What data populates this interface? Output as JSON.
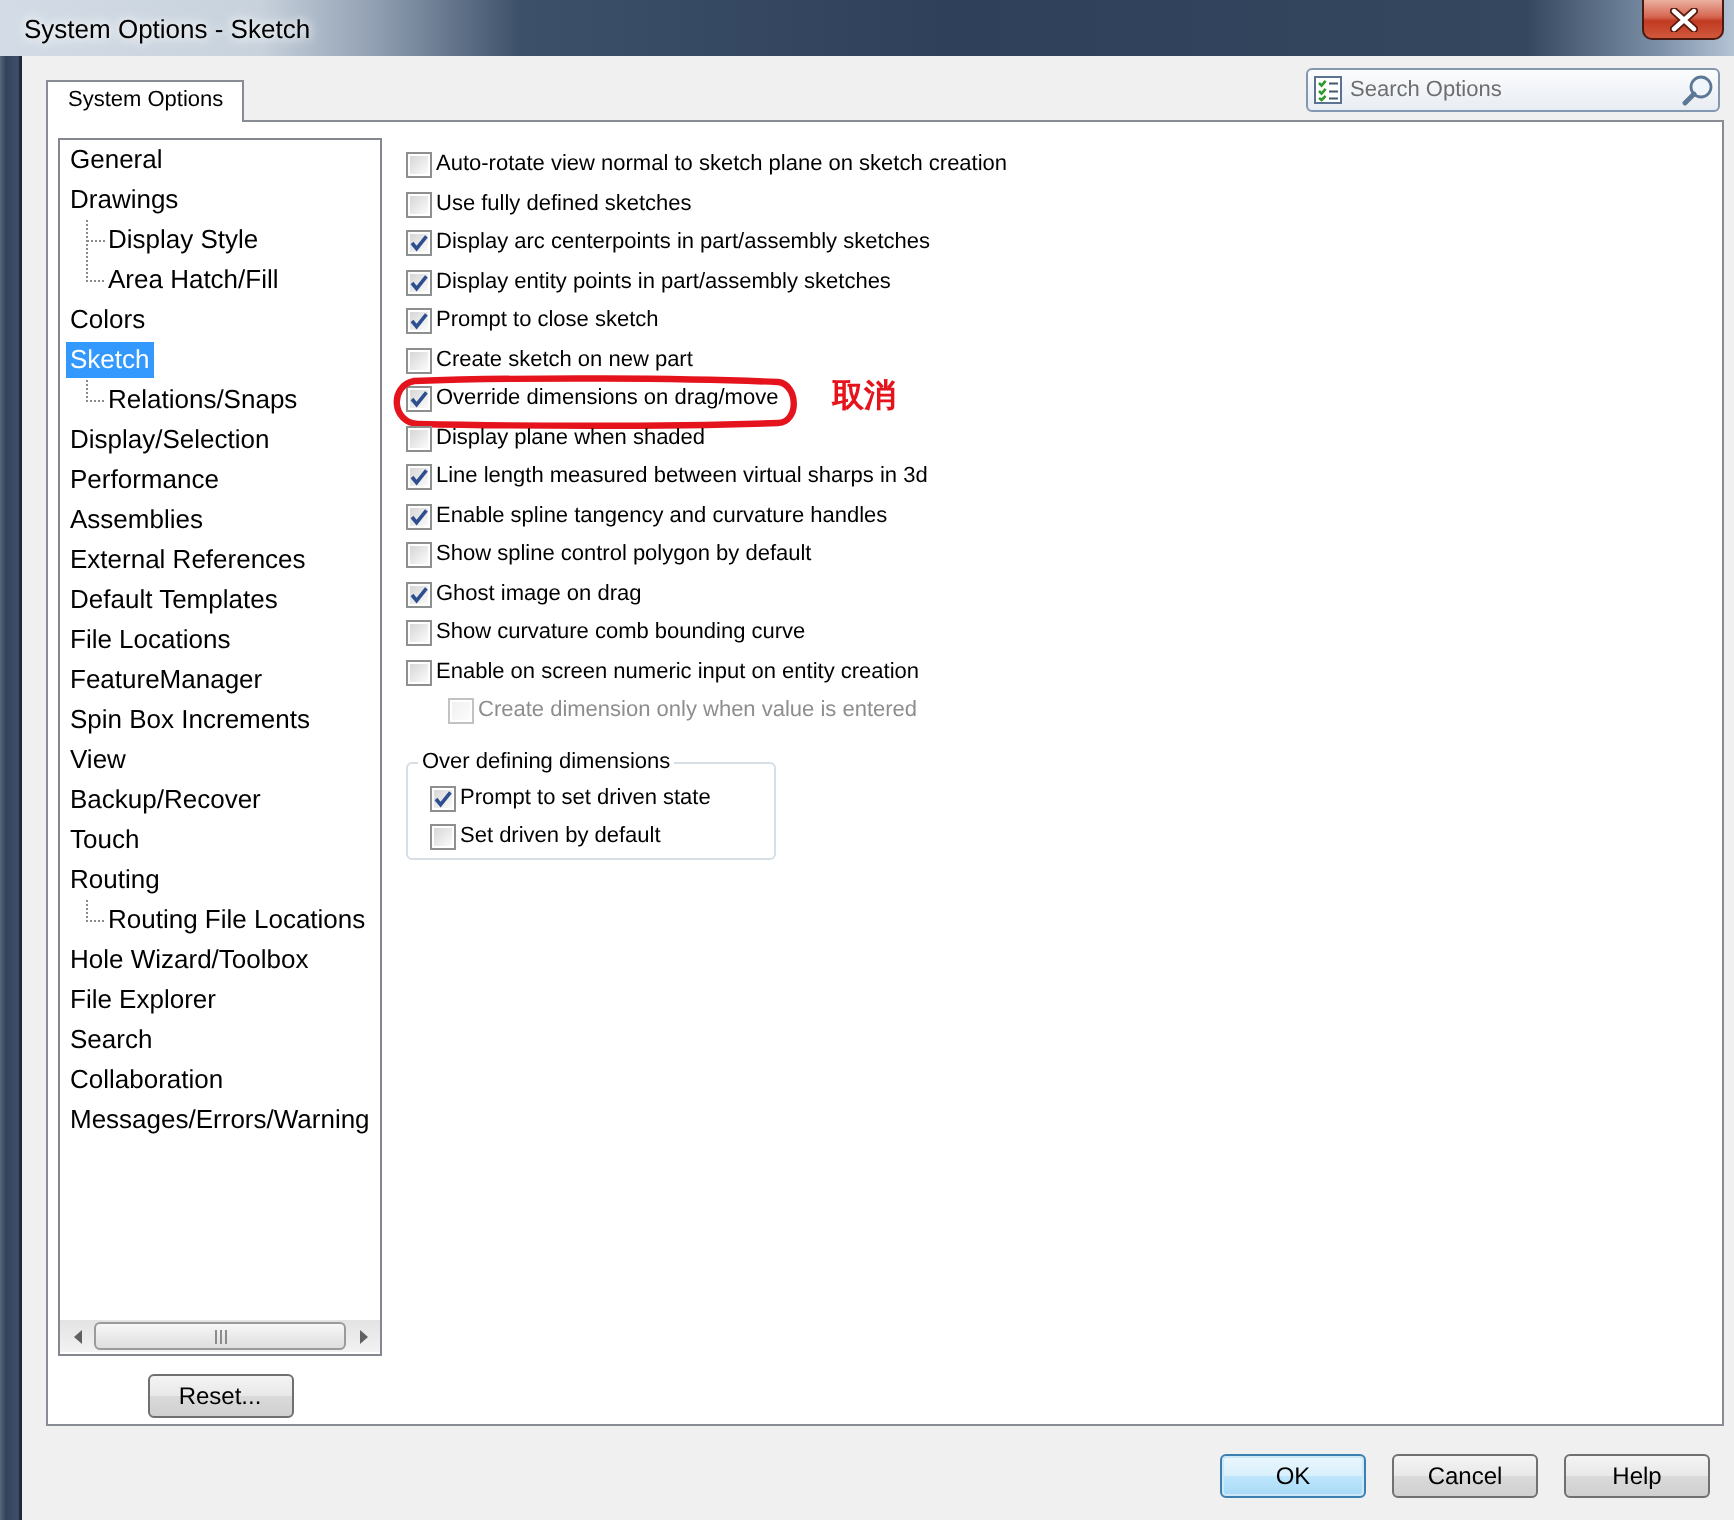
{
  "window": {
    "title": "System Options - Sketch"
  },
  "tabs": [
    {
      "label": "System Options",
      "selected": true
    }
  ],
  "search": {
    "placeholder": "Search Options"
  },
  "tree": {
    "items": [
      {
        "label": "General",
        "selected": false
      },
      {
        "label": "Drawings",
        "selected": false,
        "children": [
          {
            "label": "Display Style",
            "selected": false
          },
          {
            "label": "Area Hatch/Fill",
            "selected": false
          }
        ]
      },
      {
        "label": "Colors",
        "selected": false
      },
      {
        "label": "Sketch",
        "selected": true,
        "children": [
          {
            "label": "Relations/Snaps",
            "selected": false
          }
        ]
      },
      {
        "label": "Display/Selection",
        "selected": false
      },
      {
        "label": "Performance",
        "selected": false
      },
      {
        "label": "Assemblies",
        "selected": false
      },
      {
        "label": "External References",
        "selected": false
      },
      {
        "label": "Default Templates",
        "selected": false
      },
      {
        "label": "File Locations",
        "selected": false
      },
      {
        "label": "FeatureManager",
        "selected": false
      },
      {
        "label": "Spin Box Increments",
        "selected": false
      },
      {
        "label": "View",
        "selected": false
      },
      {
        "label": "Backup/Recover",
        "selected": false
      },
      {
        "label": "Touch",
        "selected": false
      },
      {
        "label": "Routing",
        "selected": false,
        "children": [
          {
            "label": "Routing File Locations",
            "selected": false
          }
        ]
      },
      {
        "label": "Hole Wizard/Toolbox",
        "selected": false
      },
      {
        "label": "File Explorer",
        "selected": false
      },
      {
        "label": "Search",
        "selected": false
      },
      {
        "label": "Collaboration",
        "selected": false
      },
      {
        "label": "Messages/Errors/Warning",
        "selected": false
      }
    ]
  },
  "reset_button": {
    "label": "Reset..."
  },
  "options": [
    {
      "label": "Auto-rotate view normal to sketch plane on sketch creation",
      "checked": false,
      "disabled": false,
      "circled": false
    },
    {
      "label": "Use fully defined sketches",
      "checked": false,
      "disabled": false,
      "circled": false
    },
    {
      "label": "Display arc centerpoints in part/assembly sketches",
      "checked": true,
      "disabled": false,
      "circled": false
    },
    {
      "label": "Display entity points in part/assembly sketches",
      "checked": true,
      "disabled": false,
      "circled": false
    },
    {
      "label": "Prompt to close sketch",
      "checked": true,
      "disabled": false,
      "circled": false
    },
    {
      "label": "Create sketch on new part",
      "checked": false,
      "disabled": false,
      "circled": false
    },
    {
      "label": "Override dimensions on drag/move",
      "checked": true,
      "disabled": false,
      "circled": true,
      "note": "取消"
    },
    {
      "label": "Display plane when shaded",
      "checked": false,
      "disabled": false,
      "circled": false
    },
    {
      "label": "Line length measured between virtual sharps in 3d",
      "checked": true,
      "disabled": false,
      "circled": false
    },
    {
      "label": "Enable spline tangency and curvature handles",
      "checked": true,
      "disabled": false,
      "circled": false
    },
    {
      "label": "Show spline control polygon by default",
      "checked": false,
      "disabled": false,
      "circled": false
    },
    {
      "label": "Ghost image on drag",
      "checked": true,
      "disabled": false,
      "circled": false
    },
    {
      "label": "Show curvature comb bounding curve",
      "checked": false,
      "disabled": false,
      "circled": false
    },
    {
      "label": "Enable on screen numeric input on entity creation",
      "checked": false,
      "disabled": false,
      "circled": false,
      "children": [
        {
          "label": "Create dimension only when value is entered",
          "checked": false,
          "disabled": true,
          "circled": false
        }
      ]
    }
  ],
  "group": {
    "title": "Over defining dimensions",
    "options": [
      {
        "label": "Prompt to set driven state",
        "checked": true,
        "disabled": false
      },
      {
        "label": "Set driven by default",
        "checked": false,
        "disabled": false
      }
    ]
  },
  "buttons": [
    {
      "label": "OK",
      "default": true
    },
    {
      "label": "Cancel",
      "default": false
    },
    {
      "label": "Help",
      "default": false
    }
  ]
}
